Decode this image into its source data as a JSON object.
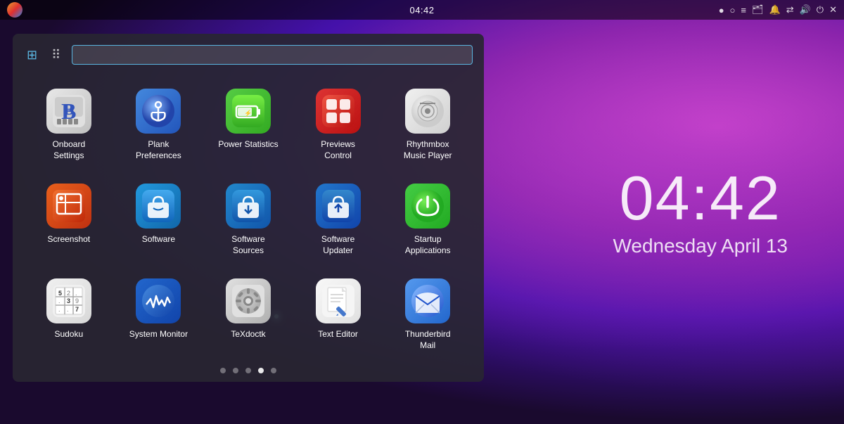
{
  "topbar": {
    "time": "04:42",
    "indicators": [
      "●",
      "○",
      "≡",
      "🗂",
      "🔔",
      "⇄",
      "🔊",
      "⏻",
      "✕"
    ]
  },
  "clock": {
    "time": "04:42",
    "date": "Wednesday April 13"
  },
  "launcher": {
    "search_placeholder": "",
    "view_all_label": "⊞",
    "view_grid_label": "⠿",
    "apps": [
      {
        "id": "onboard-settings",
        "label": "Onboard Settings",
        "icon_type": "onboard"
      },
      {
        "id": "plank-preferences",
        "label": "Plank Preferences",
        "icon_type": "plank"
      },
      {
        "id": "power-statistics",
        "label": "Power Statistics",
        "icon_type": "power"
      },
      {
        "id": "previews-control",
        "label": "Previews Control",
        "icon_type": "previews"
      },
      {
        "id": "rhythmbox",
        "label": "Rhythmbox Music Player",
        "icon_type": "rhythmbox"
      },
      {
        "id": "screenshot",
        "label": "Screenshot",
        "icon_type": "screenshot"
      },
      {
        "id": "software",
        "label": "Software",
        "icon_type": "software"
      },
      {
        "id": "software-sources",
        "label": "Software Sources",
        "icon_type": "sources"
      },
      {
        "id": "software-updater",
        "label": "Software Updater",
        "icon_type": "updater"
      },
      {
        "id": "startup-applications",
        "label": "Startup Applications",
        "icon_type": "startup"
      },
      {
        "id": "sudoku",
        "label": "Sudoku",
        "icon_type": "sudoku"
      },
      {
        "id": "system-monitor",
        "label": "System Monitor",
        "icon_type": "sysmon"
      },
      {
        "id": "texdoctk",
        "label": "TeXdoctk",
        "icon_type": "texdoc"
      },
      {
        "id": "text-editor",
        "label": "Text Editor",
        "icon_type": "texteditor"
      },
      {
        "id": "thunderbird-mail",
        "label": "Thunderbird Mail",
        "icon_type": "thunderbird"
      }
    ],
    "dots": [
      {
        "active": false
      },
      {
        "active": false
      },
      {
        "active": false
      },
      {
        "active": true
      },
      {
        "active": false
      }
    ]
  }
}
